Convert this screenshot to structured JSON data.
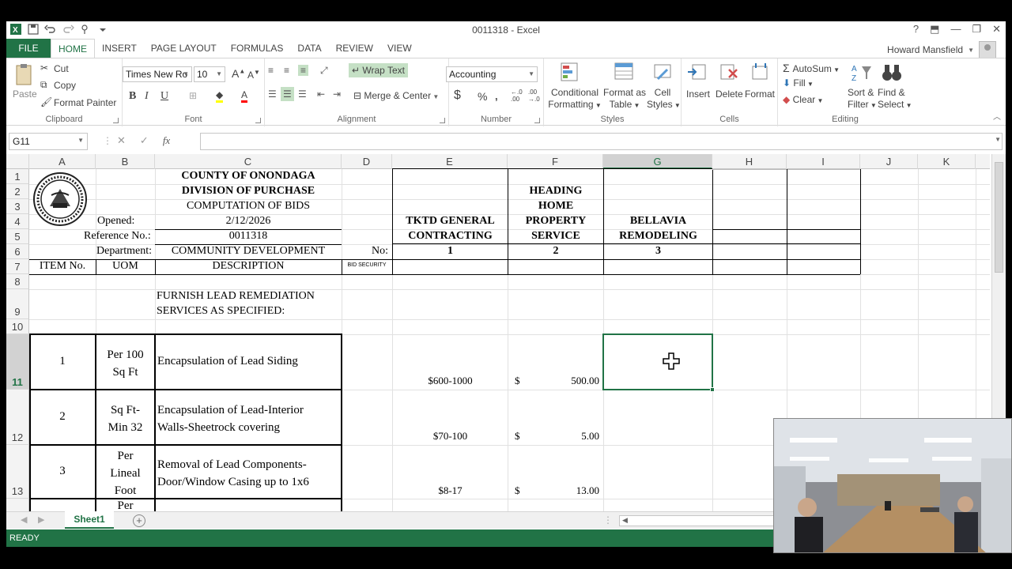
{
  "app": {
    "title": "0011318 - Excel",
    "user": "Howard Mansfield"
  },
  "tabs": [
    "HOME",
    "INSERT",
    "PAGE LAYOUT",
    "FORMULAS",
    "DATA",
    "REVIEW",
    "VIEW"
  ],
  "file_tab": "FILE",
  "ribbon": {
    "clipboard": {
      "label": "Clipboard",
      "paste": "Paste",
      "cut": "Cut",
      "copy": "Copy",
      "format_painter": "Format Painter"
    },
    "font": {
      "label": "Font",
      "name": "Times New Ro",
      "size": "10",
      "bold": "B",
      "italic": "I",
      "underline": "U"
    },
    "alignment": {
      "label": "Alignment",
      "wrap": "Wrap Text",
      "merge": "Merge & Center"
    },
    "number": {
      "label": "Number",
      "format": "Accounting",
      "currency": "$",
      "percent": "%",
      "comma": "9"
    },
    "styles": {
      "label": "Styles",
      "conditional_1": "Conditional",
      "conditional_2": "Formatting",
      "format_as_1": "Format as",
      "format_as_2": "Table",
      "cell_styles_1": "Cell",
      "cell_styles_2": "Styles"
    },
    "cells": {
      "label": "Cells",
      "insert": "Insert",
      "delete": "Delete",
      "format": "Format"
    },
    "editing": {
      "label": "Editing",
      "autosum": "AutoSum",
      "fill": "Fill",
      "clear": "Clear",
      "sort_1": "Sort &",
      "sort_2": "Filter",
      "find_1": "Find &",
      "find_2": "Select"
    }
  },
  "formula_bar": {
    "name_box": "G11",
    "fx": "fx",
    "value": ""
  },
  "columns": [
    "A",
    "B",
    "C",
    "D",
    "E",
    "F",
    "G",
    "H",
    "I",
    "J",
    "K"
  ],
  "rows": [
    "1",
    "2",
    "3",
    "4",
    "5",
    "6",
    "7",
    "8",
    "9",
    "10",
    "11",
    "12",
    "13"
  ],
  "sheet": {
    "header_1": "COUNTY OF ONONDAGA",
    "header_2": "DIVISION OF PURCHASE",
    "header_3": "COMPUTATION OF BIDS",
    "opened_label": "Opened:",
    "opened_value": "2/12/2026",
    "ref_label": "Reference No.:",
    "ref_value": "0011318",
    "dept_label": "Department:",
    "dept_value": "COMMUNITY DEVELOPMENT",
    "no_label": "No:",
    "vendor_1_a": "TKTD GENERAL",
    "vendor_1_b": "CONTRACTING",
    "vendor_2_a": "HEADING",
    "vendor_2_b": "HOME",
    "vendor_2_c": "PROPERTY",
    "vendor_2_d": "SERVICE",
    "vendor_3_a": "BELLAVIA",
    "vendor_3_b": "REMODELING",
    "vendor_no_1": "1",
    "vendor_no_2": "2",
    "vendor_no_3": "3",
    "col_item": "ITEM No.",
    "col_uom": "UOM",
    "col_desc": "DESCRIPTION",
    "col_bid_security": "BID SECURITY",
    "section_1": "FURNISH LEAD REMEDIATION",
    "section_2": "SERVICES AS SPECIFIED:",
    "items": [
      {
        "no": "1",
        "uom_1": "Per 100",
        "uom_2": "Sq Ft",
        "uom_3": "",
        "desc_1": "Encapsulation of Lead Siding",
        "desc_2": "",
        "e": "$600-1000",
        "f_cur": "$",
        "f_val": "500.00"
      },
      {
        "no": "2",
        "uom_1": "Sq Ft-",
        "uom_2": "Min 32",
        "uom_3": "",
        "desc_1": "Encapsulation of Lead-Interior",
        "desc_2": "Walls-Sheetrock covering",
        "e": "$70-100",
        "f_cur": "$",
        "f_val": "5.00"
      },
      {
        "no": "3",
        "uom_1": "Per",
        "uom_2": "Lineal",
        "uom_3": "Foot",
        "desc_1": "Removal of Lead Components-",
        "desc_2": "Door/Window Casing up to 1x6",
        "e": "$8-17",
        "f_cur": "$",
        "f_val": "13.00"
      }
    ],
    "partial_row_uom": "Per"
  },
  "sheet_tab": "Sheet1",
  "status": "READY",
  "colors": {
    "excel_green": "#217346",
    "grid_line": "#e1e1e1",
    "header_bg": "#f3f3f3"
  }
}
